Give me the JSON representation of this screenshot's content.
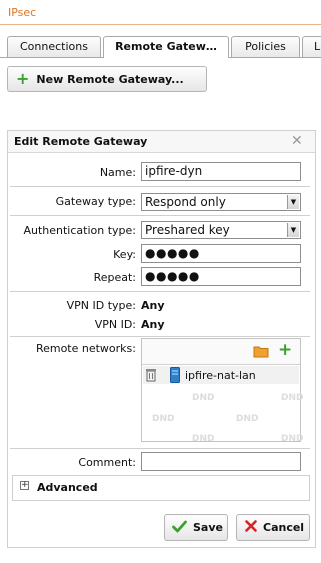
{
  "page": {
    "title": "IPsec"
  },
  "tabs": [
    {
      "label": "Connections"
    },
    {
      "label": "Remote Gatew…"
    },
    {
      "label": "Policies"
    },
    {
      "label": "L"
    }
  ],
  "toolbar": {
    "new_button_label": "New Remote Gateway..."
  },
  "dialog": {
    "title": "Edit Remote Gateway",
    "fields": {
      "name": {
        "label": "Name:",
        "value": "ipfire-dyn"
      },
      "gateway_type": {
        "label": "Gateway type:",
        "value": "Respond only"
      },
      "auth_type": {
        "label": "Authentication type:",
        "value": "Preshared key"
      },
      "key": {
        "label": "Key:",
        "value": "●●●●●"
      },
      "repeat": {
        "label": "Repeat:",
        "value": "●●●●●"
      },
      "vpn_id_type": {
        "label": "VPN ID type:",
        "value": "Any"
      },
      "vpn_id": {
        "label": "VPN ID:",
        "value": "Any"
      },
      "remote_networks": {
        "label": "Remote networks:",
        "items": [
          "ipfire-nat-lan"
        ],
        "drop_hint": "DND"
      },
      "comment": {
        "label": "Comment:",
        "value": ""
      }
    },
    "advanced": {
      "label": "Advanced",
      "expander": "+"
    },
    "buttons": {
      "save": "Save",
      "cancel": "Cancel"
    }
  },
  "colors": {
    "title_orange": "#e3741d",
    "add_green": "#3aa12c",
    "cancel_red": "#d8232a",
    "folder_orange": "#f0a030",
    "network_blue": "#2f7fc9"
  },
  "icons": {
    "add": "plus-icon",
    "close": "close-icon",
    "folder": "folder-icon",
    "trash": "trash-icon",
    "network": "network-icon",
    "save": "checkmark-icon",
    "cancel": "x-icon"
  }
}
